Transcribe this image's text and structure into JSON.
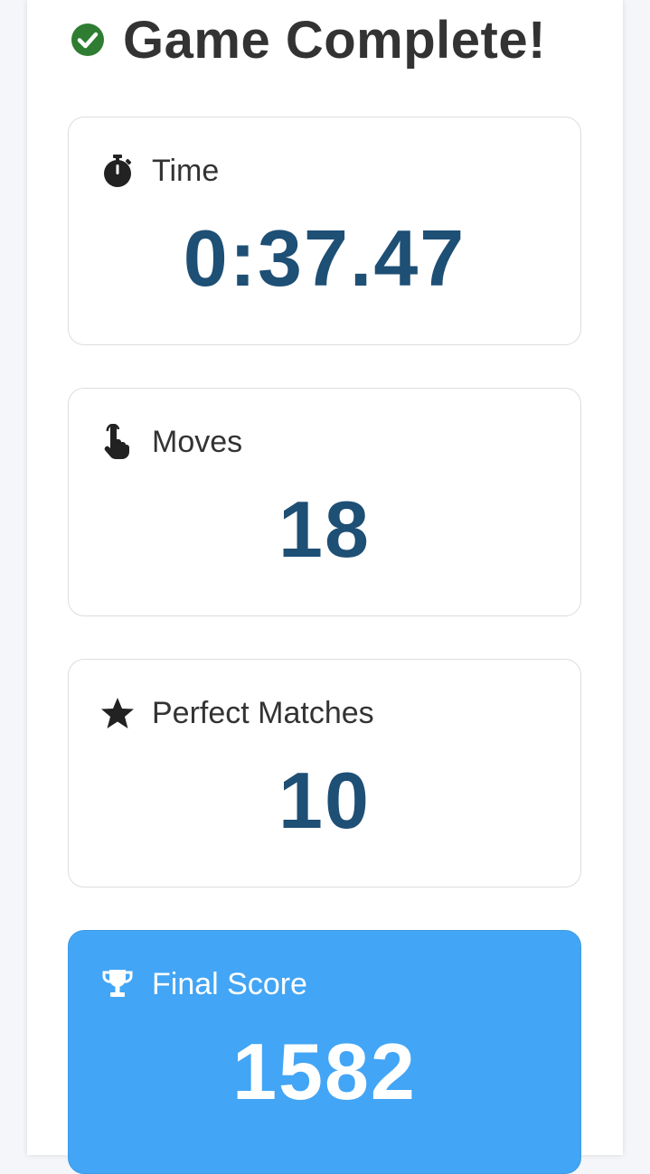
{
  "header": {
    "title": "Game Complete!",
    "icon": "check-circle-icon"
  },
  "stats": {
    "time": {
      "label": "Time",
      "value": "0:37.47",
      "icon": "stopwatch-icon"
    },
    "moves": {
      "label": "Moves",
      "value": "18",
      "icon": "pointing-hand-icon"
    },
    "perfect_matches": {
      "label": "Perfect Matches",
      "value": "10",
      "icon": "star-icon"
    },
    "final_score": {
      "label": "Final Score",
      "value": "1582",
      "icon": "trophy-icon"
    }
  },
  "colors": {
    "success": "#2e7d32",
    "value_text": "#1e4f75",
    "score_card": "#42a5f5"
  }
}
